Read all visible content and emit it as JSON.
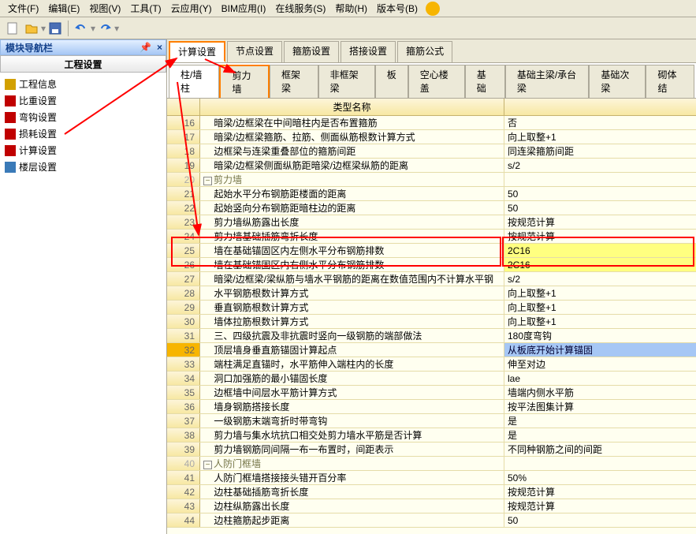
{
  "menu": [
    "文件(F)",
    "编辑(E)",
    "视图(V)",
    "工具(T)",
    "云应用(Y)",
    "BIM应用(I)",
    "在线服务(S)",
    "帮助(H)",
    "版本号(B)"
  ],
  "sidebar": {
    "title": "模块导航栏",
    "subtitle": "工程设置",
    "items": [
      {
        "label": "工程信息",
        "icon": "#d2a000"
      },
      {
        "label": "比重设置",
        "icon": "#c00000"
      },
      {
        "label": "弯钩设置",
        "icon": "#c00000"
      },
      {
        "label": "损耗设置",
        "icon": "#c00000"
      },
      {
        "label": "计算设置",
        "icon": "#c00000"
      },
      {
        "label": "楼层设置",
        "icon": "#3a7ab8"
      }
    ]
  },
  "tabs1": [
    "计算设置",
    "节点设置",
    "箍筋设置",
    "搭接设置",
    "箍筋公式"
  ],
  "tabs2": [
    "柱/墙柱",
    "剪力墙",
    "框架梁",
    "非框架梁",
    "板",
    "空心楼盖",
    "基础",
    "基础主梁/承台梁",
    "基础次梁",
    "砌体结"
  ],
  "grid": {
    "headName": "类型名称",
    "rows": [
      {
        "n": 16,
        "name": "暗梁/边框梁在中间暗柱内是否布置箍筋",
        "val": "否"
      },
      {
        "n": 17,
        "name": "暗梁/边框梁箍筋、拉筋、侧面纵筋根数计算方式",
        "val": "向上取整+1"
      },
      {
        "n": 18,
        "name": "边框梁与连梁重叠部位的箍筋间距",
        "val": "同连梁箍筋间距"
      },
      {
        "n": 19,
        "name": "暗梁/边框梁侧面纵筋距暗梁/边框梁纵筋的距离",
        "val": "s/2"
      },
      {
        "n": 20,
        "name": "剪力墙",
        "val": "",
        "group": true,
        "exp": "−"
      },
      {
        "n": 21,
        "name": "起始水平分布钢筋距楼面的距离",
        "val": "50"
      },
      {
        "n": 22,
        "name": "起始竖向分布钢筋距暗柱边的距离",
        "val": "50"
      },
      {
        "n": 23,
        "name": "剪力墙纵筋露出长度",
        "val": "按规范计算"
      },
      {
        "n": 24,
        "name": "剪力墙基础插筋弯折长度",
        "val": "按规范计算"
      },
      {
        "n": 25,
        "name": "墙在基础锚固区内左侧水平分布钢筋排数",
        "val": "2C16",
        "red": true,
        "hlv": true
      },
      {
        "n": 26,
        "name": "墙在基础锚固区内右侧水平分布钢筋排数",
        "val": "2C16",
        "red": true,
        "hlv": true
      },
      {
        "n": 27,
        "name": "暗梁/边框梁/梁纵筋与墙水平钢筋的距离在数值范围内不计算水平钢",
        "val": "s/2"
      },
      {
        "n": 28,
        "name": "水平钢筋根数计算方式",
        "val": "向上取整+1"
      },
      {
        "n": 29,
        "name": "垂直钢筋根数计算方式",
        "val": "向上取整+1"
      },
      {
        "n": 30,
        "name": "墙体拉筋根数计算方式",
        "val": "向上取整+1"
      },
      {
        "n": 31,
        "name": "三、四级抗震及非抗震时竖向一级钢筋的端部做法",
        "val": "180度弯钩"
      },
      {
        "n": 32,
        "name": "顶层墙身垂直筋锚固计算起点",
        "val": "从板底开始计算锚固",
        "sel": true
      },
      {
        "n": 33,
        "name": "端柱满足直锚时，水平筋伸入端柱内的长度",
        "val": "伸至对边"
      },
      {
        "n": 34,
        "name": "洞口加强筋的最小锚固长度",
        "val": "lae"
      },
      {
        "n": 35,
        "name": "边框墙中间层水平筋计算方式",
        "val": "墙端内侧水平筋"
      },
      {
        "n": 36,
        "name": "墙身钢筋搭接长度",
        "val": "按平法图集计算"
      },
      {
        "n": 37,
        "name": "一级钢筋末端弯折时带弯钩",
        "val": "是"
      },
      {
        "n": 38,
        "name": "剪力墙与集水坑抗口相交处剪力墙水平筋是否计算",
        "val": "是"
      },
      {
        "n": 39,
        "name": "剪力墙钢筋同间隔一布一布置时，间距表示",
        "val": "不同种钢筋之间的间距"
      },
      {
        "n": 40,
        "name": "人防门框墙",
        "val": "",
        "group": true,
        "exp": "−"
      },
      {
        "n": 41,
        "name": "人防门框墙搭接接头错开百分率",
        "val": "50%"
      },
      {
        "n": 42,
        "name": "边柱基础插筋弯折长度",
        "val": "按规范计算"
      },
      {
        "n": 43,
        "name": "边柱纵筋露出长度",
        "val": "按规范计算"
      },
      {
        "n": 44,
        "name": "边柱箍筋起步距离",
        "val": "50"
      }
    ]
  }
}
